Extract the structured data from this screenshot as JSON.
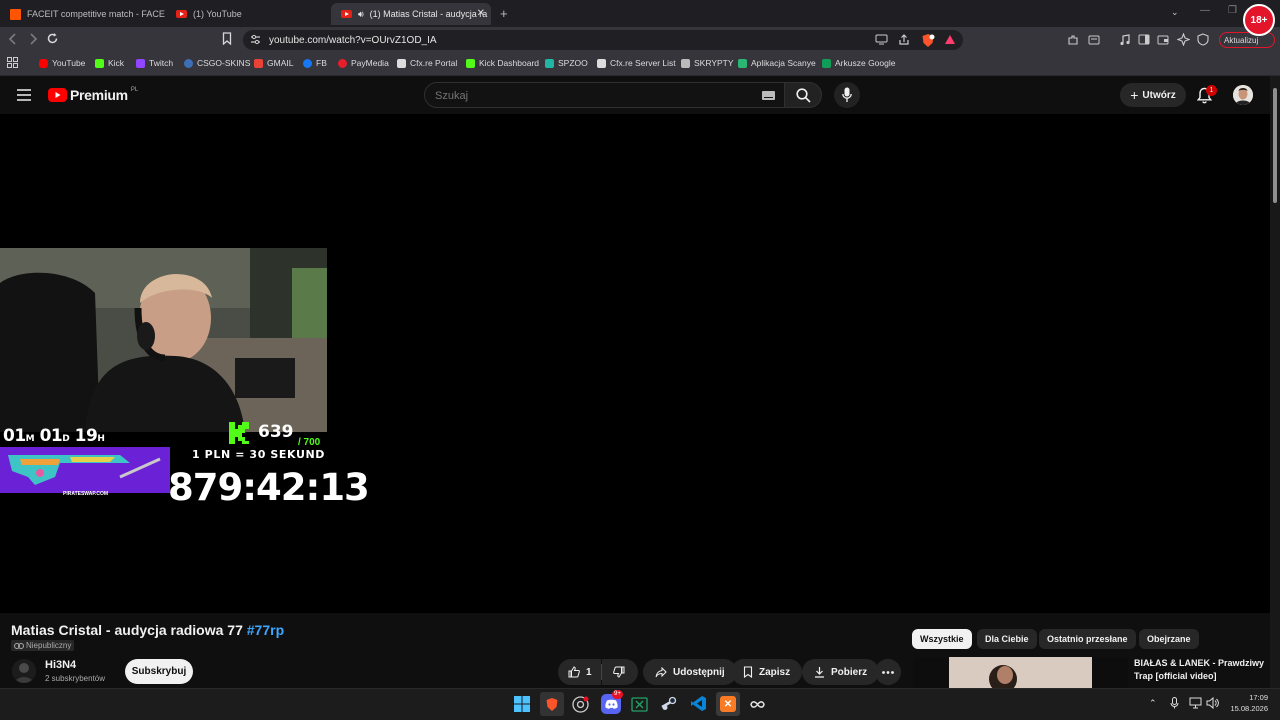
{
  "browser": {
    "tabs": [
      {
        "title": "FACEIT competitive match - FACEIT.c",
        "icon": "faceit-icon"
      },
      {
        "title": "(1) YouTube",
        "icon": "youtube-icon"
      },
      {
        "title": "(1) Matias Cristal - audycja ra",
        "icon": "youtube-icon"
      }
    ],
    "url": "youtube.com/watch?v=OUrvZ1OD_IA",
    "update_label": "Aktualizuj",
    "profile_badge": "18+",
    "bookmarks": [
      "YouTube",
      "Kick",
      "Twitch",
      "CSGO-SKINS",
      "GMAIL",
      "FB",
      "PayMedia",
      "Cfx.re Portal",
      "Kick Dashboard",
      "SPZOO",
      "Cfx.re Server List",
      "SKRYPTY",
      "Aplikacja Scanye",
      "Arkusze Google"
    ]
  },
  "youtube": {
    "logo_text": "Premium",
    "logo_region": "PL",
    "search_placeholder": "Szukaj",
    "create_label": "Utwórz",
    "notification_count": "1"
  },
  "stream_overlay": {
    "subathon_time": {
      "m": "01",
      "d": "01",
      "h": "19",
      "m_unit": "M",
      "d_unit": "D",
      "h_unit": "H"
    },
    "kick_followers": "639",
    "kick_goal": "/ 700",
    "rate_text": "1 PLN = 30 SEKUND",
    "countdown": "879:42:13",
    "sponsor_site": "PIRATESWAP.COM"
  },
  "video": {
    "title": "Matias Cristal - audycja radiowa 77",
    "hashtag": "#77rp",
    "visibility": "Niepubliczny",
    "channel_name": "Hi3N4",
    "subscribers": "2 subskrybentów",
    "subscribe_label": "Subskrybuj",
    "like_count": "1",
    "share_label": "Udostępnij",
    "save_label": "Zapisz",
    "download_label": "Pobierz"
  },
  "sidebar": {
    "chips": [
      "Wszystkie",
      "Dla Ciebie",
      "Ostatnio przesłane",
      "Obejrzane"
    ],
    "recommendation_title": "BIAŁAS & LANEK - Prawdziwy Trap [official video]"
  },
  "taskbar": {
    "time": "17:09",
    "date": "15.08.2026",
    "discord_badge": "9+"
  },
  "colors": {
    "youtube_red": "#ff0000",
    "kick_green": "#53fc18",
    "link_blue": "#3ea6ff"
  }
}
